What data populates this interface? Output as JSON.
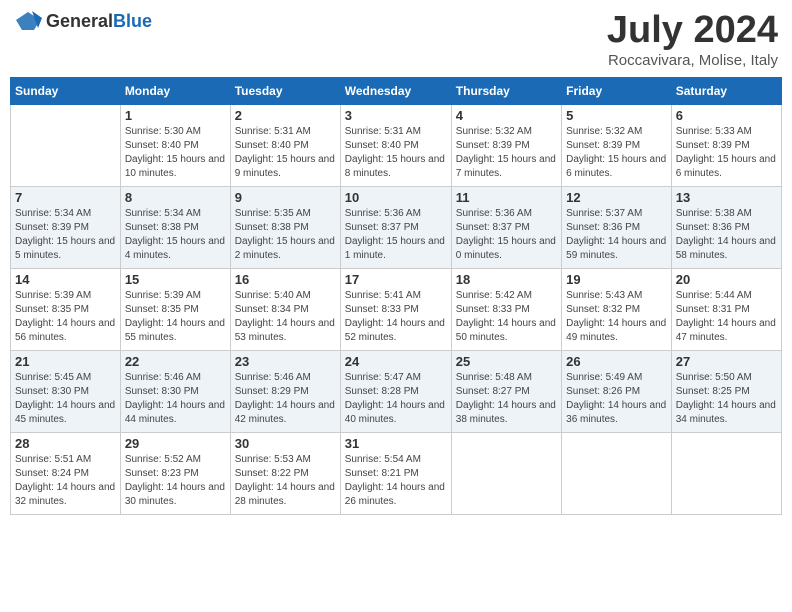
{
  "logo": {
    "general": "General",
    "blue": "Blue"
  },
  "title": "July 2024",
  "location": "Roccavivara, Molise, Italy",
  "headers": [
    "Sunday",
    "Monday",
    "Tuesday",
    "Wednesday",
    "Thursday",
    "Friday",
    "Saturday"
  ],
  "weeks": [
    [
      {
        "day": "",
        "sunrise": "",
        "sunset": "",
        "daylight": ""
      },
      {
        "day": "1",
        "sunrise": "Sunrise: 5:30 AM",
        "sunset": "Sunset: 8:40 PM",
        "daylight": "Daylight: 15 hours and 10 minutes."
      },
      {
        "day": "2",
        "sunrise": "Sunrise: 5:31 AM",
        "sunset": "Sunset: 8:40 PM",
        "daylight": "Daylight: 15 hours and 9 minutes."
      },
      {
        "day": "3",
        "sunrise": "Sunrise: 5:31 AM",
        "sunset": "Sunset: 8:40 PM",
        "daylight": "Daylight: 15 hours and 8 minutes."
      },
      {
        "day": "4",
        "sunrise": "Sunrise: 5:32 AM",
        "sunset": "Sunset: 8:39 PM",
        "daylight": "Daylight: 15 hours and 7 minutes."
      },
      {
        "day": "5",
        "sunrise": "Sunrise: 5:32 AM",
        "sunset": "Sunset: 8:39 PM",
        "daylight": "Daylight: 15 hours and 6 minutes."
      },
      {
        "day": "6",
        "sunrise": "Sunrise: 5:33 AM",
        "sunset": "Sunset: 8:39 PM",
        "daylight": "Daylight: 15 hours and 6 minutes."
      }
    ],
    [
      {
        "day": "7",
        "sunrise": "Sunrise: 5:34 AM",
        "sunset": "Sunset: 8:39 PM",
        "daylight": "Daylight: 15 hours and 5 minutes."
      },
      {
        "day": "8",
        "sunrise": "Sunrise: 5:34 AM",
        "sunset": "Sunset: 8:38 PM",
        "daylight": "Daylight: 15 hours and 4 minutes."
      },
      {
        "day": "9",
        "sunrise": "Sunrise: 5:35 AM",
        "sunset": "Sunset: 8:38 PM",
        "daylight": "Daylight: 15 hours and 2 minutes."
      },
      {
        "day": "10",
        "sunrise": "Sunrise: 5:36 AM",
        "sunset": "Sunset: 8:37 PM",
        "daylight": "Daylight: 15 hours and 1 minute."
      },
      {
        "day": "11",
        "sunrise": "Sunrise: 5:36 AM",
        "sunset": "Sunset: 8:37 PM",
        "daylight": "Daylight: 15 hours and 0 minutes."
      },
      {
        "day": "12",
        "sunrise": "Sunrise: 5:37 AM",
        "sunset": "Sunset: 8:36 PM",
        "daylight": "Daylight: 14 hours and 59 minutes."
      },
      {
        "day": "13",
        "sunrise": "Sunrise: 5:38 AM",
        "sunset": "Sunset: 8:36 PM",
        "daylight": "Daylight: 14 hours and 58 minutes."
      }
    ],
    [
      {
        "day": "14",
        "sunrise": "Sunrise: 5:39 AM",
        "sunset": "Sunset: 8:35 PM",
        "daylight": "Daylight: 14 hours and 56 minutes."
      },
      {
        "day": "15",
        "sunrise": "Sunrise: 5:39 AM",
        "sunset": "Sunset: 8:35 PM",
        "daylight": "Daylight: 14 hours and 55 minutes."
      },
      {
        "day": "16",
        "sunrise": "Sunrise: 5:40 AM",
        "sunset": "Sunset: 8:34 PM",
        "daylight": "Daylight: 14 hours and 53 minutes."
      },
      {
        "day": "17",
        "sunrise": "Sunrise: 5:41 AM",
        "sunset": "Sunset: 8:33 PM",
        "daylight": "Daylight: 14 hours and 52 minutes."
      },
      {
        "day": "18",
        "sunrise": "Sunrise: 5:42 AM",
        "sunset": "Sunset: 8:33 PM",
        "daylight": "Daylight: 14 hours and 50 minutes."
      },
      {
        "day": "19",
        "sunrise": "Sunrise: 5:43 AM",
        "sunset": "Sunset: 8:32 PM",
        "daylight": "Daylight: 14 hours and 49 minutes."
      },
      {
        "day": "20",
        "sunrise": "Sunrise: 5:44 AM",
        "sunset": "Sunset: 8:31 PM",
        "daylight": "Daylight: 14 hours and 47 minutes."
      }
    ],
    [
      {
        "day": "21",
        "sunrise": "Sunrise: 5:45 AM",
        "sunset": "Sunset: 8:30 PM",
        "daylight": "Daylight: 14 hours and 45 minutes."
      },
      {
        "day": "22",
        "sunrise": "Sunrise: 5:46 AM",
        "sunset": "Sunset: 8:30 PM",
        "daylight": "Daylight: 14 hours and 44 minutes."
      },
      {
        "day": "23",
        "sunrise": "Sunrise: 5:46 AM",
        "sunset": "Sunset: 8:29 PM",
        "daylight": "Daylight: 14 hours and 42 minutes."
      },
      {
        "day": "24",
        "sunrise": "Sunrise: 5:47 AM",
        "sunset": "Sunset: 8:28 PM",
        "daylight": "Daylight: 14 hours and 40 minutes."
      },
      {
        "day": "25",
        "sunrise": "Sunrise: 5:48 AM",
        "sunset": "Sunset: 8:27 PM",
        "daylight": "Daylight: 14 hours and 38 minutes."
      },
      {
        "day": "26",
        "sunrise": "Sunrise: 5:49 AM",
        "sunset": "Sunset: 8:26 PM",
        "daylight": "Daylight: 14 hours and 36 minutes."
      },
      {
        "day": "27",
        "sunrise": "Sunrise: 5:50 AM",
        "sunset": "Sunset: 8:25 PM",
        "daylight": "Daylight: 14 hours and 34 minutes."
      }
    ],
    [
      {
        "day": "28",
        "sunrise": "Sunrise: 5:51 AM",
        "sunset": "Sunset: 8:24 PM",
        "daylight": "Daylight: 14 hours and 32 minutes."
      },
      {
        "day": "29",
        "sunrise": "Sunrise: 5:52 AM",
        "sunset": "Sunset: 8:23 PM",
        "daylight": "Daylight: 14 hours and 30 minutes."
      },
      {
        "day": "30",
        "sunrise": "Sunrise: 5:53 AM",
        "sunset": "Sunset: 8:22 PM",
        "daylight": "Daylight: 14 hours and 28 minutes."
      },
      {
        "day": "31",
        "sunrise": "Sunrise: 5:54 AM",
        "sunset": "Sunset: 8:21 PM",
        "daylight": "Daylight: 14 hours and 26 minutes."
      },
      {
        "day": "",
        "sunrise": "",
        "sunset": "",
        "daylight": ""
      },
      {
        "day": "",
        "sunrise": "",
        "sunset": "",
        "daylight": ""
      },
      {
        "day": "",
        "sunrise": "",
        "sunset": "",
        "daylight": ""
      }
    ]
  ]
}
